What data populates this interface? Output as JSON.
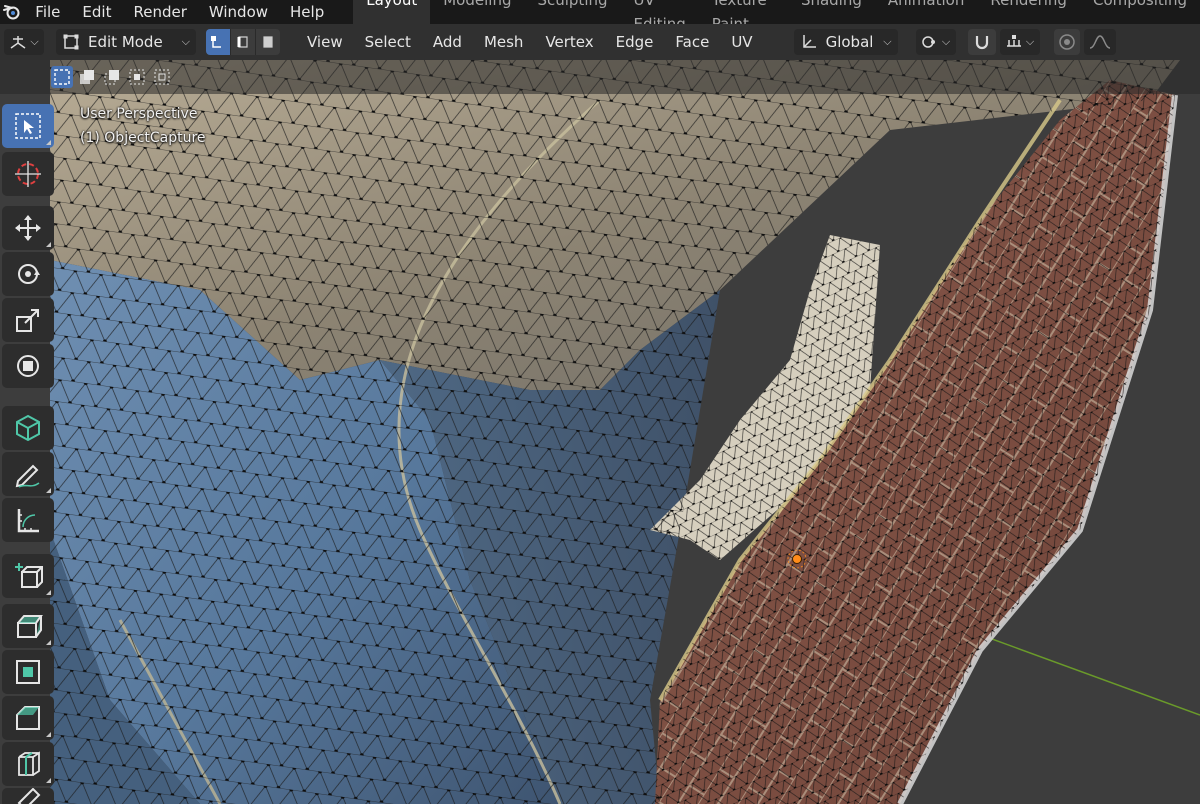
{
  "menubar": {
    "items": [
      "File",
      "Edit",
      "Render",
      "Window",
      "Help"
    ]
  },
  "workspaces": {
    "tabs": [
      "Layout",
      "Modeling",
      "Sculpting",
      "UV Editing",
      "Texture Paint",
      "Shading",
      "Animation",
      "Rendering",
      "Compositing"
    ],
    "active": "Layout"
  },
  "header": {
    "mode": "Edit Mode",
    "menus": [
      "View",
      "Select",
      "Add",
      "Mesh",
      "Vertex",
      "Edge",
      "Face",
      "UV"
    ],
    "transform_orientation": "Global"
  },
  "viewport": {
    "perspective_label": "User Perspective",
    "object_label": "(1) ObjectCapture"
  },
  "colors": {
    "accent": "#4772b3",
    "topbar_bg": "#191919",
    "header_bg": "#303030",
    "grid_axis": "#6a9a2a",
    "origin": "#ff8c1a"
  },
  "icons": {
    "editor_type": "viewport-icon",
    "vertex_mode": "vertex-select-icon",
    "edge_mode": "edge-select-icon",
    "face_mode": "face-select-icon",
    "orientation": "orientation-icon",
    "pivot": "link-icon",
    "snap": "magnet-icon",
    "snap_target": "snap-increment-icon",
    "proportional": "proportional-edit-icon",
    "falloff": "falloff-icon"
  },
  "toolbar": {
    "tools": [
      "select-box",
      "cursor",
      "move",
      "rotate",
      "scale",
      "transform",
      "annotate-mesh",
      "annotate",
      "measure",
      "add-cube",
      "extrude",
      "inset",
      "bevel",
      "loop-cut",
      "knife"
    ],
    "active": "select-box"
  }
}
